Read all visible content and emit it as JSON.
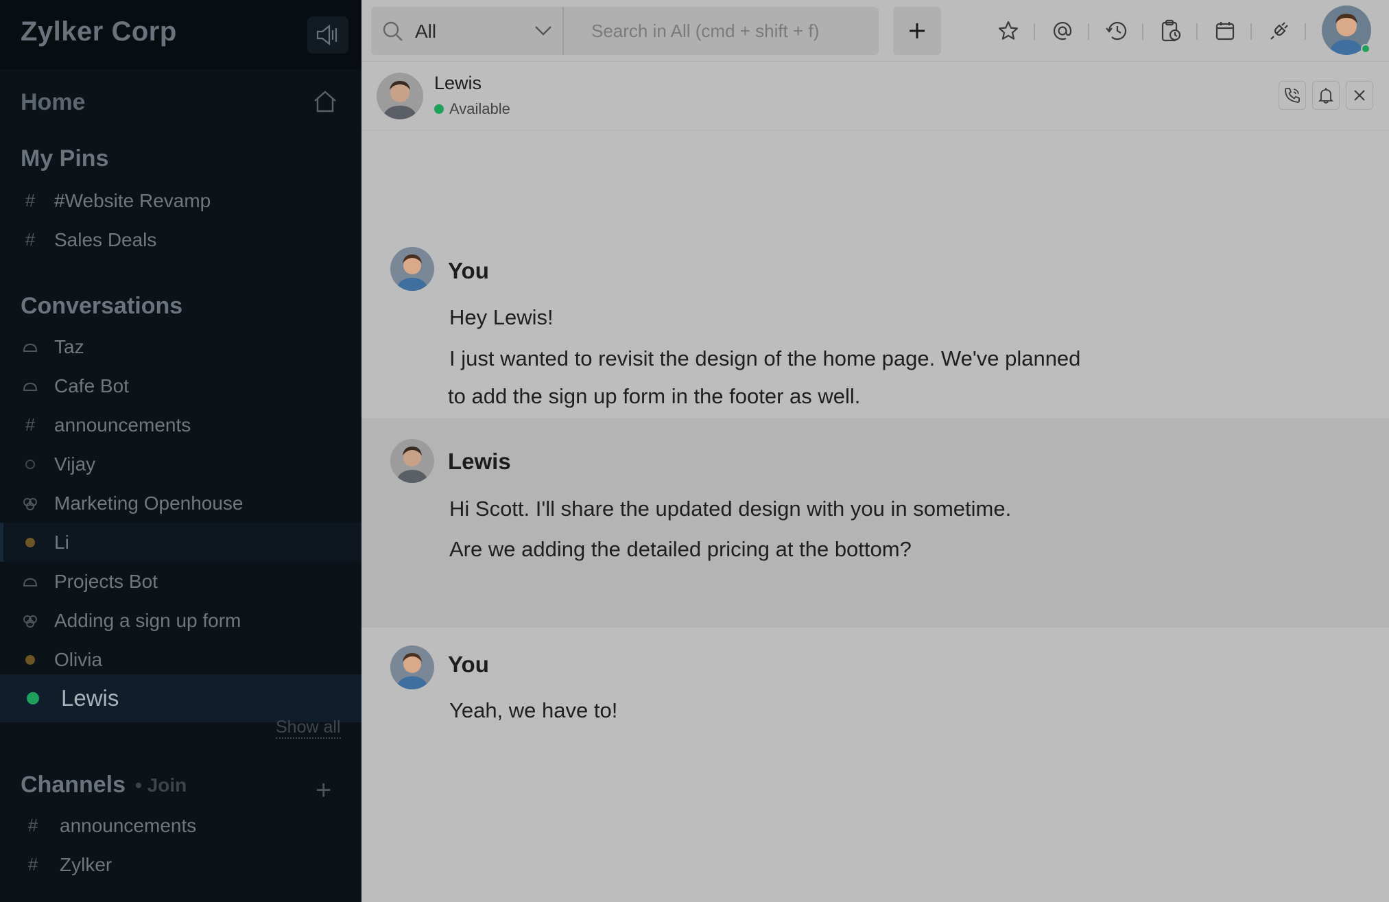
{
  "sidebar": {
    "brand": "Zylker Corp",
    "home": "Home",
    "pins_title": "My Pins",
    "pins": [
      {
        "label": "#Website Revamp",
        "icon": "hash-icon"
      },
      {
        "label": "Sales Deals",
        "icon": "hash-icon"
      }
    ],
    "conversations_title": "Conversations",
    "conversations": [
      {
        "label": "Taz",
        "icon": "bot-icon"
      },
      {
        "label": "Cafe Bot",
        "icon": "bot-icon"
      },
      {
        "label": "announcements",
        "icon": "hash-icon"
      },
      {
        "label": "Vijay",
        "icon": "offline-status-icon"
      },
      {
        "label": "Marketing Openhouse",
        "icon": "group-icon"
      },
      {
        "label": "Li",
        "icon": "away-status-icon"
      },
      {
        "label": "Projects Bot",
        "icon": "bot-icon"
      },
      {
        "label": "Adding a sign up form",
        "icon": "group-icon"
      },
      {
        "label": "Olivia",
        "icon": "away-status-icon"
      },
      {
        "label": "Lewis",
        "icon": "online-status-icon"
      }
    ],
    "show_all": "Show all",
    "channels_title": "Channels",
    "channels_join": "Join",
    "channels": [
      {
        "label": "announcements",
        "icon": "hash-icon"
      },
      {
        "label": "Zylker",
        "icon": "hash-icon"
      }
    ]
  },
  "topbar": {
    "scope": "All",
    "search_placeholder": "Search in All (cmd + shift + f)"
  },
  "chat": {
    "contact_name": "Lewis",
    "contact_status": "Available",
    "messages": [
      {
        "sender": "You",
        "lines": [
          "Hey Lewis!",
          "I just wanted to revisit the design of the home page. We've planned",
          "to add the sign up form in the footer as well."
        ]
      },
      {
        "sender": "Lewis",
        "lines": [
          "Hi Scott. I'll share the updated design with you in sometime.",
          "Are we adding the detailed pricing at the bottom?"
        ]
      },
      {
        "sender": "You",
        "lines": [
          "Yeah, we have to!"
        ]
      }
    ]
  },
  "colors": {
    "online": "#1fa05b",
    "away": "#8a6a2a",
    "sidebar_bg": "#0b1218",
    "chat_bg": "#bdbdbd"
  }
}
